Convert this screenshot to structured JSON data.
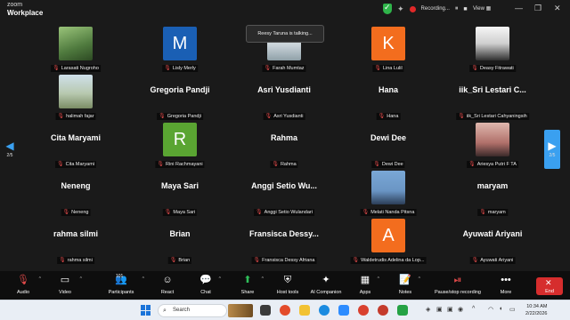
{
  "app": {
    "brand_line1": "zoom",
    "brand_line2": "Workplace"
  },
  "titlebar": {
    "recording_label": "Recording...",
    "pause_label": "⏸",
    "stop_label": "■",
    "view_label": "View",
    "view_caret": "▦"
  },
  "talking": "Reesy Taruna is talking...",
  "pager": {
    "left": "2/5",
    "right": "2/5"
  },
  "tiles": [
    {
      "big": "",
      "label": "Larasati Nugroho",
      "avatar_type": "photo",
      "avatar_text": "",
      "photo": "photo1",
      "color": ""
    },
    {
      "big": "",
      "label": "Lisly Merly",
      "avatar_type": "letter",
      "avatar_text": "M",
      "photo": "",
      "color": "#1a5fb4"
    },
    {
      "big": "",
      "label": "Farah Mumtaz",
      "avatar_type": "photo",
      "avatar_text": "",
      "photo": "photo2",
      "color": ""
    },
    {
      "big": "",
      "label": "Lina Lulil",
      "avatar_type": "letter",
      "avatar_text": "K",
      "photo": "",
      "color": "#f36d1e"
    },
    {
      "big": "",
      "label": "Deasy Fitrawati",
      "avatar_type": "photo",
      "avatar_text": "",
      "photo": "photo4",
      "color": ""
    },
    {
      "big": "",
      "label": "halimah fajar",
      "avatar_type": "photo",
      "avatar_text": "",
      "photo": "photo3",
      "color": ""
    },
    {
      "big": "Gregoria Pandji",
      "label": "Gregoria Pandji",
      "avatar_type": "none",
      "avatar_text": "",
      "photo": "",
      "color": ""
    },
    {
      "big": "Asri Yusdianti",
      "label": "Asri Yusdianti",
      "avatar_type": "none",
      "avatar_text": "",
      "photo": "",
      "color": ""
    },
    {
      "big": "Hana",
      "label": "Hana",
      "avatar_type": "none",
      "avatar_text": "",
      "photo": "",
      "color": ""
    },
    {
      "big": "iik_Sri Lestari C...",
      "label": "iik_Sri Lestari Cahyaningsih",
      "avatar_type": "none",
      "avatar_text": "",
      "photo": "",
      "color": ""
    },
    {
      "big": "Cita Maryami",
      "label": "Cita Maryami",
      "avatar_type": "none",
      "avatar_text": "",
      "photo": "",
      "color": ""
    },
    {
      "big": "",
      "label": "Rini Rachmayani",
      "avatar_type": "letter",
      "avatar_text": "R",
      "photo": "",
      "color": "#5aa532"
    },
    {
      "big": "Rahma",
      "label": "Rahma",
      "avatar_type": "none",
      "avatar_text": "",
      "photo": "",
      "color": ""
    },
    {
      "big": "Dewi Dee",
      "label": "Dewi Dee",
      "avatar_type": "none",
      "avatar_text": "",
      "photo": "",
      "color": ""
    },
    {
      "big": "",
      "label": "Ariesya Putri F TA",
      "avatar_type": "photo",
      "avatar_text": "",
      "photo": "photo5",
      "color": ""
    },
    {
      "big": "Neneng",
      "label": "Neneng",
      "avatar_type": "none",
      "avatar_text": "",
      "photo": "",
      "color": ""
    },
    {
      "big": "Maya Sari",
      "label": "Maya Sari",
      "avatar_type": "none",
      "avatar_text": "",
      "photo": "",
      "color": ""
    },
    {
      "big": "Anggi Setio Wu...",
      "label": "Anggi Setio Wulandari",
      "avatar_type": "none",
      "avatar_text": "",
      "photo": "",
      "color": ""
    },
    {
      "big": "",
      "label": "Melati Nanda Pitsna",
      "avatar_type": "photo",
      "avatar_text": "",
      "photo": "photo6",
      "color": ""
    },
    {
      "big": "maryam",
      "label": "maryam",
      "avatar_type": "none",
      "avatar_text": "",
      "photo": "",
      "color": ""
    },
    {
      "big": "rahma silmi",
      "label": "rahma silmi",
      "avatar_type": "none",
      "avatar_text": "",
      "photo": "",
      "color": ""
    },
    {
      "big": "Brian",
      "label": "Brian",
      "avatar_type": "none",
      "avatar_text": "",
      "photo": "",
      "color": ""
    },
    {
      "big": "Fransisca Dessy...",
      "label": "Fransisca Dessy Afriana",
      "avatar_type": "none",
      "avatar_text": "",
      "photo": "",
      "color": ""
    },
    {
      "big": "",
      "label": "Waldetrudis Adelina da Lop...",
      "avatar_type": "letter",
      "avatar_text": "A",
      "photo": "",
      "color": "#f36d1e"
    },
    {
      "big": "Ayuwati Ariyani",
      "label": "Ayuwati Ariyani",
      "avatar_type": "none",
      "avatar_text": "",
      "photo": "",
      "color": ""
    }
  ],
  "toolbar": {
    "audio": "Audio",
    "video": "Video",
    "participants": "Participants",
    "participants_count": "101",
    "react": "React",
    "chat": "Chat",
    "share": "Share",
    "host_tools": "Host tools",
    "ai_companion": "AI Companion",
    "apps": "Apps",
    "notes": "Notes",
    "record": "Pause/stop recording",
    "more": "More",
    "end": "End"
  },
  "taskbar": {
    "search_placeholder": "Search",
    "time": "10:34 AM",
    "date": "2/22/2026"
  },
  "colors": {
    "accent_blue": "#3aa0f0",
    "end_red": "#d62d2d",
    "share_green": "#2fbf5a"
  }
}
